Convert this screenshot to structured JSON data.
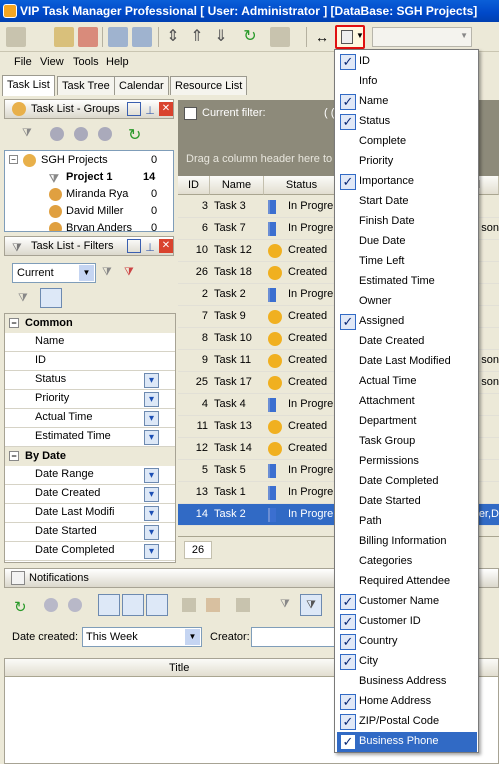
{
  "window": {
    "title": "VIP Task Manager Professional [ User: Administrator ] [DataBase: SGH Projects]"
  },
  "menubar": [
    "File",
    "View",
    "Tools",
    "Help"
  ],
  "tabs": [
    "Task List",
    "Task Tree",
    "Calendar",
    "Resource List"
  ],
  "groups_panel": {
    "title": "Task List - Groups",
    "items": [
      {
        "label": "SGH Projects",
        "count": "0"
      },
      {
        "label": "Project 1",
        "count": "14"
      },
      {
        "label": "Miranda Rya",
        "count": "0"
      },
      {
        "label": "David Miller",
        "count": "0"
      },
      {
        "label": "Bryan Anders",
        "count": "0"
      }
    ]
  },
  "filters_panel": {
    "title": "Task List - Filters",
    "current_value": "Current",
    "categories": [
      {
        "name": "Common",
        "rows": [
          "Name",
          "ID",
          "Status",
          "Priority",
          "Actual Time",
          "Estimated Time"
        ]
      },
      {
        "name": "By Date",
        "rows": [
          "Date Range",
          "Date Created",
          "Date Last Modifi",
          "Date Started",
          "Date Completed"
        ]
      }
    ]
  },
  "grid": {
    "current_filter_label": "Current filter:",
    "filter_paren": "( (",
    "group_hint": "Drag a column header here to g",
    "columns": [
      "ID",
      "Name",
      "Status",
      "d"
    ],
    "rows": [
      {
        "id": "3",
        "name": "Task 3",
        "status": "In Progre",
        "icon": "progress",
        "extra": ""
      },
      {
        "id": "6",
        "name": "Task 7",
        "status": "In Progre",
        "icon": "progress",
        "extra": "son"
      },
      {
        "id": "10",
        "name": "Task 12",
        "status": "Created",
        "icon": "created",
        "extra": ""
      },
      {
        "id": "26",
        "name": "Task 18",
        "status": "Created",
        "icon": "created",
        "extra": ""
      },
      {
        "id": "2",
        "name": "Task 2",
        "status": "In Progre",
        "icon": "progress",
        "extra": ""
      },
      {
        "id": "7",
        "name": "Task 9",
        "status": "Created",
        "icon": "created",
        "extra": ""
      },
      {
        "id": "8",
        "name": "Task 10",
        "status": "Created",
        "icon": "created",
        "extra": ""
      },
      {
        "id": "9",
        "name": "Task 11",
        "status": "Created",
        "icon": "created",
        "extra": "son"
      },
      {
        "id": "25",
        "name": "Task 17",
        "status": "Created",
        "icon": "created",
        "extra": "son"
      },
      {
        "id": "4",
        "name": "Task 4",
        "status": "In Progre",
        "icon": "progress",
        "extra": ""
      },
      {
        "id": "11",
        "name": "Task 13",
        "status": "Created",
        "icon": "created",
        "extra": ""
      },
      {
        "id": "12",
        "name": "Task 14",
        "status": "Created",
        "icon": "created",
        "extra": ""
      },
      {
        "id": "5",
        "name": "Task 5",
        "status": "In Progre",
        "icon": "progress",
        "extra": ""
      },
      {
        "id": "13",
        "name": "Task 1",
        "status": "In Progre",
        "icon": "progress",
        "extra": ""
      },
      {
        "id": "14",
        "name": "Task 2",
        "status": "In Progre",
        "icon": "progress",
        "extra": "zer,D"
      }
    ],
    "footer_count": "26",
    "selected_row": 14
  },
  "notifications": {
    "title": "Notifications",
    "date_created_label": "Date created:",
    "date_created_value": "This Week",
    "creator_label": "Creator:",
    "table_header": "Title"
  },
  "column_menu": {
    "items": [
      {
        "label": "ID",
        "checked": true
      },
      {
        "label": "Info",
        "checked": false
      },
      {
        "label": "Name",
        "checked": true
      },
      {
        "label": "Status",
        "checked": true
      },
      {
        "label": "Complete",
        "checked": false
      },
      {
        "label": "Priority",
        "checked": false
      },
      {
        "label": "Importance",
        "checked": true
      },
      {
        "label": "Start Date",
        "checked": false
      },
      {
        "label": "Finish Date",
        "checked": false
      },
      {
        "label": "Due Date",
        "checked": false
      },
      {
        "label": "Time Left",
        "checked": false
      },
      {
        "label": "Estimated Time",
        "checked": false
      },
      {
        "label": "Owner",
        "checked": false
      },
      {
        "label": "Assigned",
        "checked": true
      },
      {
        "label": "Date Created",
        "checked": false
      },
      {
        "label": "Date Last Modified",
        "checked": false
      },
      {
        "label": "Actual Time",
        "checked": false
      },
      {
        "label": "Attachment",
        "checked": false
      },
      {
        "label": "Department",
        "checked": false
      },
      {
        "label": "Task Group",
        "checked": false
      },
      {
        "label": "Permissions",
        "checked": false
      },
      {
        "label": "Date Completed",
        "checked": false
      },
      {
        "label": "Date Started",
        "checked": false
      },
      {
        "label": "Path",
        "checked": false
      },
      {
        "label": "Billing Information",
        "checked": false
      },
      {
        "label": "Categories",
        "checked": false
      },
      {
        "label": "Required Attendee",
        "checked": false
      },
      {
        "label": "Customer Name",
        "checked": true
      },
      {
        "label": "Customer ID",
        "checked": true
      },
      {
        "label": "Country",
        "checked": true
      },
      {
        "label": "City",
        "checked": true
      },
      {
        "label": "Business Address",
        "checked": false
      },
      {
        "label": "Home Address",
        "checked": true
      },
      {
        "label": "ZIP/Postal Code",
        "checked": true
      },
      {
        "label": "Business Phone",
        "checked": true,
        "highlighted": true
      }
    ]
  },
  "colors": {
    "titlebar": "#0a5fd8",
    "selection": "#316ac5",
    "highlight_box": "#e01010"
  }
}
